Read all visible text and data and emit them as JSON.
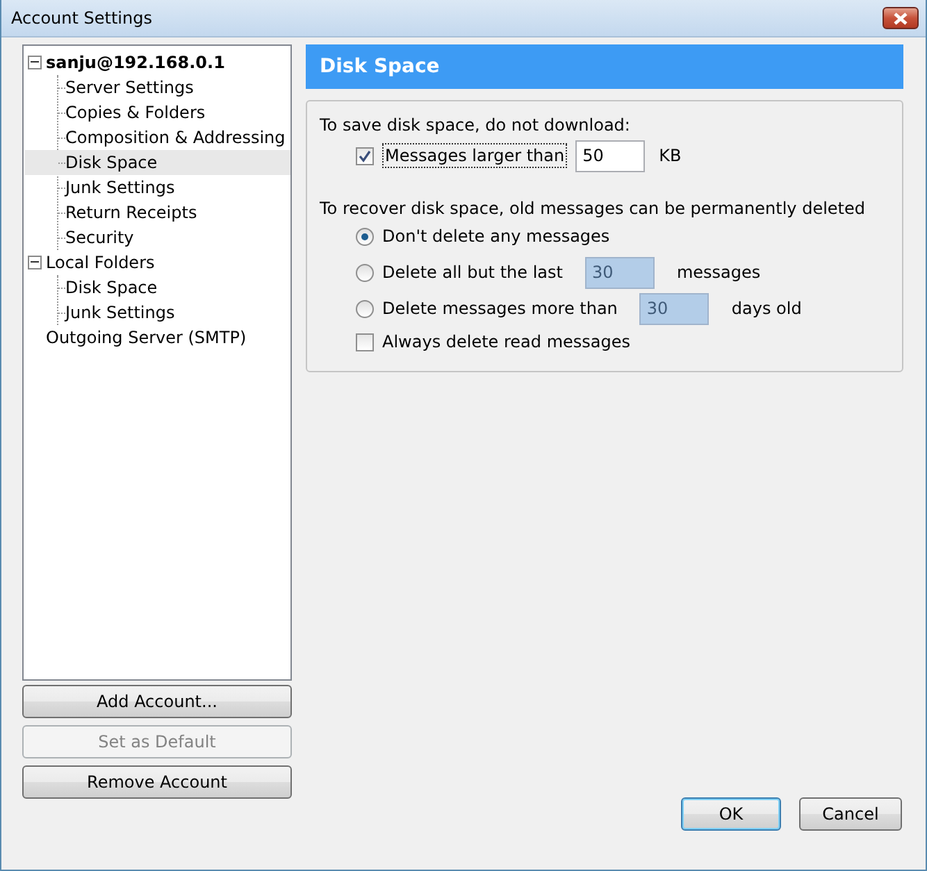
{
  "window": {
    "title": "Account Settings"
  },
  "tree": [
    {
      "label": "sanju@192.168.0.1",
      "bold": true,
      "expanded": true,
      "selected": false,
      "children": [
        {
          "label": "Server Settings",
          "selected": false
        },
        {
          "label": "Copies & Folders",
          "selected": false
        },
        {
          "label": "Composition & Addressing",
          "selected": false
        },
        {
          "label": "Disk Space",
          "selected": true
        },
        {
          "label": "Junk Settings",
          "selected": false
        },
        {
          "label": "Return Receipts",
          "selected": false
        },
        {
          "label": "Security",
          "selected": false
        }
      ]
    },
    {
      "label": "Local Folders",
      "bold": false,
      "expanded": true,
      "selected": false,
      "children": [
        {
          "label": "Disk Space",
          "selected": false
        },
        {
          "label": "Junk Settings",
          "selected": false
        }
      ]
    },
    {
      "label": "Outgoing Server (SMTP)",
      "bold": false,
      "selected": false
    }
  ],
  "account_buttons": [
    {
      "label": "Add Account...",
      "disabled": false
    },
    {
      "label": "Set as Default",
      "disabled": true
    },
    {
      "label": "Remove Account",
      "disabled": false
    }
  ],
  "panel": {
    "header": "Disk Space",
    "download": {
      "heading": "To save disk space, do not download:",
      "limit": {
        "label": "Messages larger than",
        "checked": true,
        "value": "50",
        "disabled": false,
        "unit": "KB"
      }
    },
    "retention": {
      "heading": "To recover disk space, old messages can be permanently deleted",
      "options": [
        {
          "label": "Don't delete any messages",
          "selected": true
        },
        {
          "label": "Delete all but the last",
          "selected": false,
          "value": "30",
          "disabled": true,
          "unit": "messages"
        },
        {
          "label": "Delete messages more than",
          "selected": false,
          "value": "30",
          "disabled": true,
          "unit": "days old"
        }
      ],
      "always_delete": {
        "label": "Always delete read messages",
        "checked": false
      }
    }
  },
  "dialog_buttons": [
    {
      "label": "OK",
      "default": true
    },
    {
      "label": "Cancel",
      "default": false
    }
  ]
}
